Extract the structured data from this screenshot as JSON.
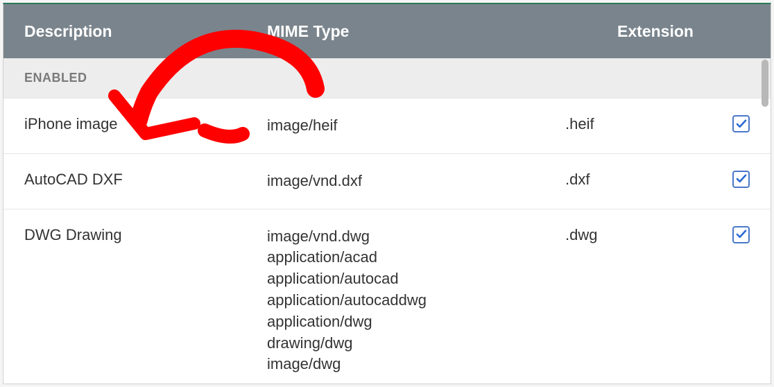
{
  "header": {
    "description": "Description",
    "mime_type": "MIME Type",
    "extension": "Extension"
  },
  "section_label": "ENABLED",
  "rows": [
    {
      "description": "iPhone image",
      "mime_types": [
        "image/heif"
      ],
      "extension": ".heif",
      "enabled": true
    },
    {
      "description": "AutoCAD DXF",
      "mime_types": [
        "image/vnd.dxf"
      ],
      "extension": ".dxf",
      "enabled": true
    },
    {
      "description": "DWG Drawing",
      "mime_types": [
        "image/vnd.dwg",
        "application/acad",
        "application/autocad",
        "application/autocaddwg",
        "application/dwg",
        "drawing/dwg",
        "image/dwg"
      ],
      "extension": ".dwg",
      "enabled": true
    }
  ],
  "annotation_color": "#ff0000"
}
